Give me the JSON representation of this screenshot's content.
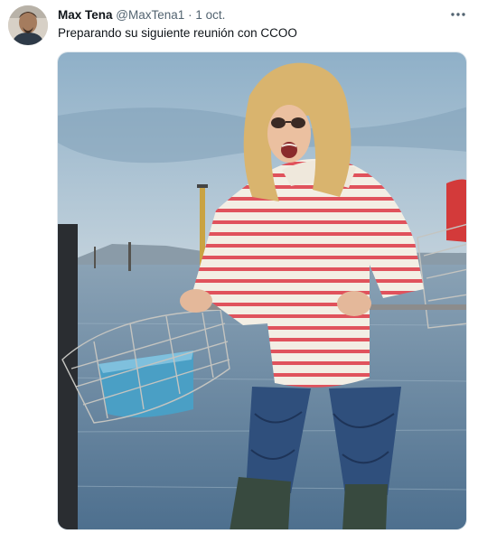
{
  "tweet": {
    "display_name": "Max Tena",
    "handle": "@MaxTena1",
    "separator": "·",
    "date": "1 oct.",
    "text": "Preparando su siguiente reunión con CCOO"
  },
  "icons": {
    "more": "more-horizontal-icon"
  },
  "colors": {
    "name_text": "#0f1419",
    "muted_text": "#536471",
    "sweater_stripe": "#e0525c",
    "sky": "#a9c2d4",
    "water": "#5d7f9e"
  }
}
